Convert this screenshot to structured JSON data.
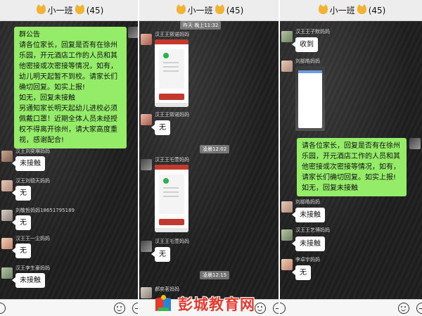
{
  "group_title": "小一班",
  "member_count": "(45)",
  "panel1": {
    "announcement": "群公告\n请各位家长，回复是否有在徐州乐园，开元酒店工作的人员和其他密接或次密接等情况，如有，幼儿明天起暂不到校。请家长们确切回复。如实上报!\n如无，回复未接触\n另通知家长明天起幼儿进校必须佩戴口罩！近期全体人员未经授权不得离开徐州，请大家高度重视，感谢配合!",
    "messages": [
      {
        "nick": "汉王刘奕琳妈妈",
        "text": "未接触"
      },
      {
        "nick": "汉王刘德天妈妈",
        "text": "无"
      },
      {
        "nick": "刘敬哲妈妈18651795189",
        "text": "无"
      },
      {
        "nick": "汉王王一尘妈妈",
        "text": "无"
      },
      {
        "nick": "汉王李生豪妈妈",
        "text": "未接触"
      }
    ]
  },
  "panel2": {
    "top_timestamp": "昨天 晚上11:32",
    "nick1": "汉王王熙诺妈妈",
    "nick2": "汉王王熙诺妈妈",
    "reply2": "无",
    "timestamp2": "凌晨12:02",
    "nick3": "汉王王乇萱妈妈",
    "nick4": "汉王王乇萱妈妈",
    "reply4": "无",
    "timestamp3": "凌晨12:15",
    "nick5": "郝奕茗妈妈"
  },
  "panel3": {
    "nick1": "汉王王子默妈妈",
    "reply1": "收到",
    "nick2": "刘部皓妈妈",
    "quote": "请各位家长，回复是否有在徐州乐园，开元酒店工作的人员和其他密接或次密接等情况，如有，请家长们确切回复。如实上报!\n如无，回复未接触",
    "nick3": "刘部皓妈妈",
    "reply3": "未接触",
    "nick4": "汉王王艺博妈妈",
    "reply4": "未接触",
    "nick5": "李卓宇妈妈",
    "reply5": "无"
  },
  "watermark": "彭城教育网",
  "icons": [
    "cat-icon",
    "emoji-icon",
    "plus-icon",
    "voice-icon"
  ]
}
